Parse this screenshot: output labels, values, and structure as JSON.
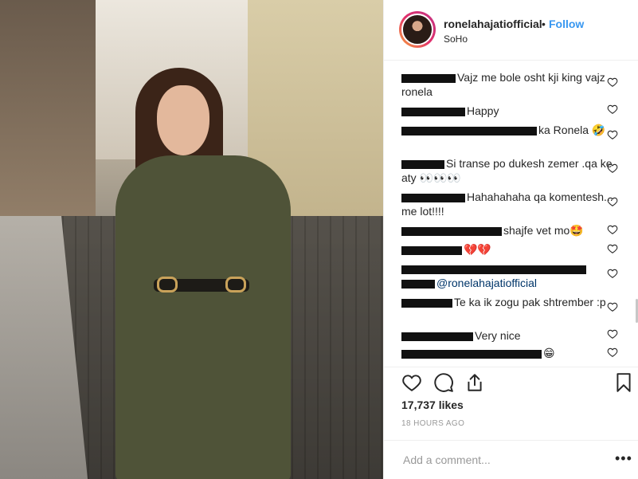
{
  "post": {
    "username": "ronelahajatiofficial",
    "separator": "•",
    "follow_label": "Follow",
    "location": "SoHo",
    "likes": "17,737 likes",
    "time": "18 HOURS AGO",
    "add_comment_placeholder": "Add a comment...",
    "more_label": "•••"
  },
  "comments": [
    {
      "text": "Vajz me bole osht kji king vajz ronela"
    },
    {
      "text": "Happy"
    },
    {
      "text": "ka Ronela 🤣"
    },
    {
      "text": "Si transe po dukesh zemer .qa ke aty 👀👀👀"
    },
    {
      "text": "Hahahahaha qa komentesh... me lot!!!!"
    },
    {
      "text": "shajfe vet mo🤩"
    },
    {
      "text": "💔💔"
    },
    {
      "text": "@ronelahajatiofficial"
    },
    {
      "text": "Te ka ik zogu pak shtrember :p"
    },
    {
      "text": "Very nice"
    },
    {
      "text": "😁"
    }
  ],
  "colors": {
    "accent": "#3897f0",
    "mention": "#003569",
    "muted": "#999999"
  }
}
